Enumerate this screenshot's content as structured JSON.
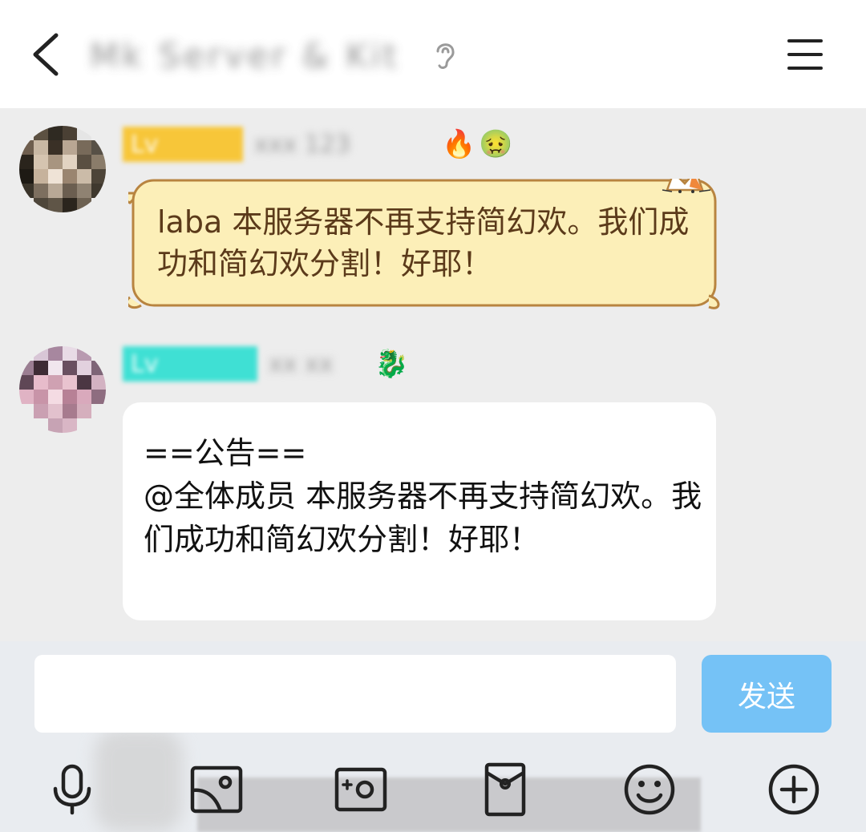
{
  "header": {
    "back_icon": "chevron-left-icon",
    "title": "Mk Server & Kit",
    "ear_icon": "ear-icon",
    "menu_icon": "hamburger-menu-icon"
  },
  "messages": [
    {
      "tag": "Lv",
      "tag_color": "#f7c639",
      "name": "xxx 123",
      "badges": [
        "🔥",
        "🤢"
      ],
      "text": "laba 本服务器不再支持简幻欢。我们成功和简幻欢分割！好耶！",
      "bubble_style": "cat-scroll"
    },
    {
      "tag": "Lv",
      "tag_color": "#3fe0d4",
      "name": "xx xx",
      "badges": [
        "🐉"
      ],
      "text": "==公告==\n@全体成员 本服务器不再支持简幻欢。我们成功和简幻欢分割！好耶！",
      "bubble_style": "plain-white"
    }
  ],
  "input": {
    "placeholder": "",
    "value": "",
    "send_label": "发送",
    "send_color": "#75c2f6"
  },
  "toolbar": [
    "microphone-icon",
    "image-icon",
    "camera-icon",
    "red-packet-icon",
    "smiley-icon",
    "plus-circle-icon"
  ]
}
